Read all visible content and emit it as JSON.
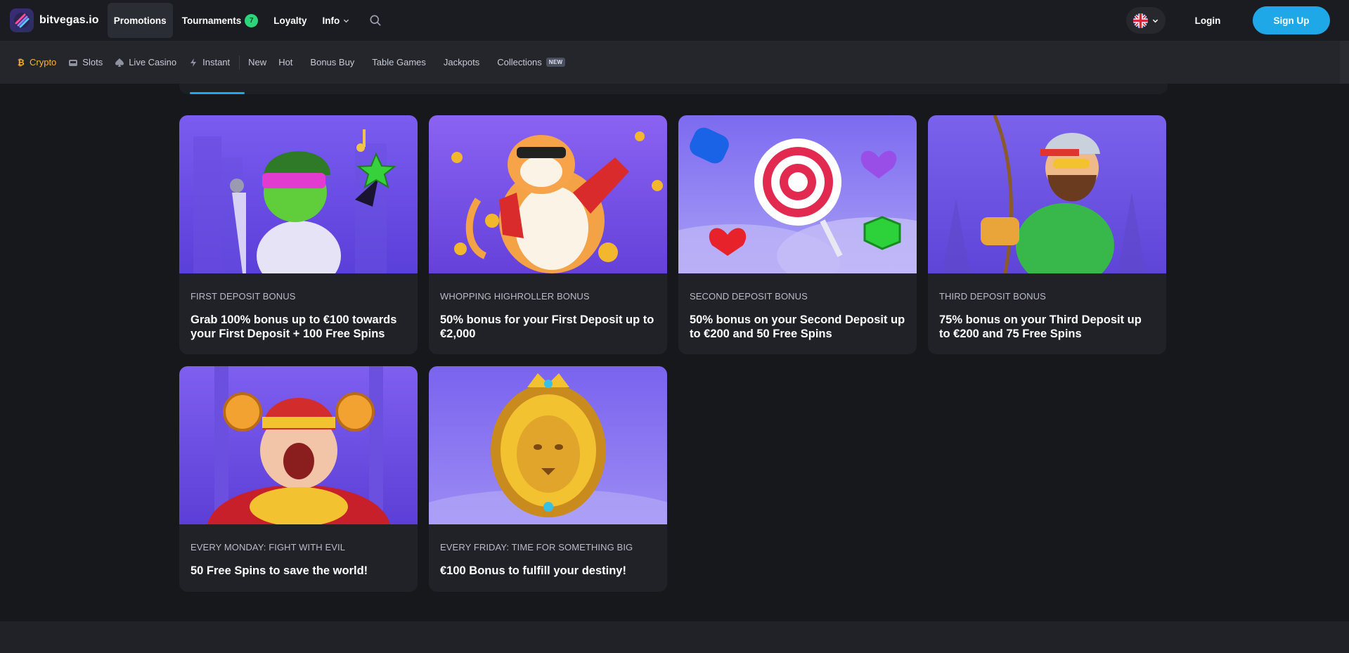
{
  "header": {
    "logo_text": "bitvegas.io",
    "nav": [
      {
        "label": "Promotions",
        "active": true
      },
      {
        "label": "Tournaments",
        "badge": "7"
      },
      {
        "label": "Loyalty"
      },
      {
        "label": "Info",
        "has_dropdown": true
      }
    ],
    "language": "en-gb",
    "login_label": "Login",
    "signup_label": "Sign Up",
    "accent_color": "#1fa8e8"
  },
  "categories": [
    {
      "label": "Crypto",
      "icon": "bitcoin-icon",
      "active": true
    },
    {
      "label": "Slots",
      "icon": "slot-machine-icon"
    },
    {
      "label": "Live Casino",
      "icon": "spade-icon"
    },
    {
      "label": "Instant",
      "icon": "lightning-icon"
    },
    {
      "label": "New"
    },
    {
      "label": "Hot"
    },
    {
      "label": "Bonus Buy"
    },
    {
      "label": "Table Games"
    },
    {
      "label": "Jackpots"
    },
    {
      "label": "Collections",
      "badge": "NEW"
    }
  ],
  "promotions": [
    {
      "kicker": "FIRST DEPOSIT BONUS",
      "title": "Grab 100% bonus up to €100 towards your First Deposit + 100 Free Spins",
      "art": "frog-singer"
    },
    {
      "kicker": "WHOPPING HIGHROLLER BONUS",
      "title": "50% bonus for your First Deposit up to €2,000",
      "art": "tiger"
    },
    {
      "kicker": "SECOND DEPOSIT BONUS",
      "title": "50% bonus on your Second Deposit up to €200 and 50 Free Spins",
      "art": "candy"
    },
    {
      "kicker": "THIRD DEPOSIT BONUS",
      "title": "75% bonus on your Third Deposit up to €200 and 75 Free Spins",
      "art": "fisherman"
    },
    {
      "kicker": "EVERY MONDAY: FIGHT WITH EVIL",
      "title": "50 Free Spins to save the world!",
      "art": "fortune-god"
    },
    {
      "kicker": "EVERY FRIDAY: TIME FOR SOMETHING BIG",
      "title": "€100 Bonus to fulfill your destiny!",
      "art": "golden-lion"
    }
  ]
}
